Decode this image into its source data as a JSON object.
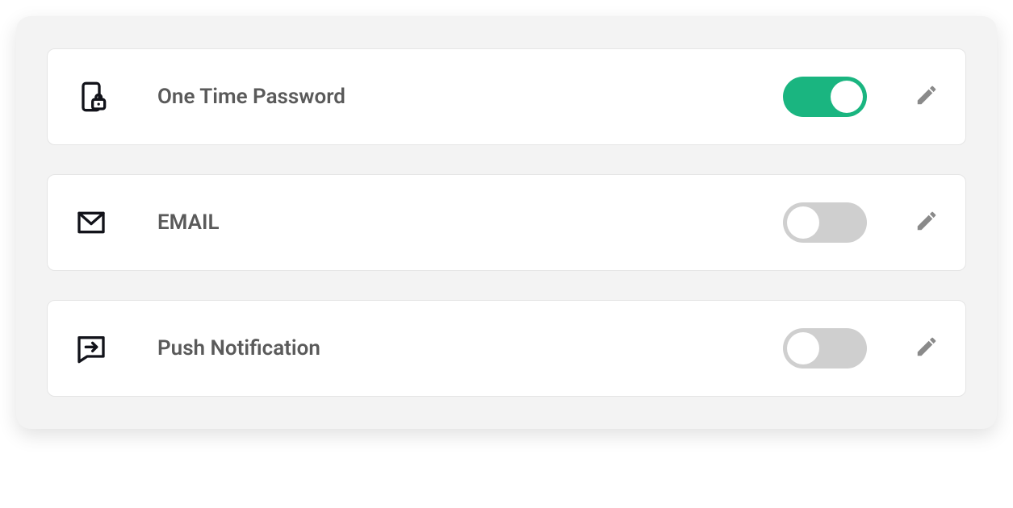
{
  "settings": [
    {
      "label": "One Time Password",
      "icon": "device-lock-icon",
      "enabled": true
    },
    {
      "label": "EMAIL",
      "icon": "email-icon",
      "enabled": false
    },
    {
      "label": "Push Notification",
      "icon": "chat-arrow-icon",
      "enabled": false
    }
  ],
  "colors": {
    "toggle_on": "#1ab580",
    "toggle_off": "#cfcfcf",
    "icon_stroke": "#12131a",
    "edit_icon": "#8a8a8a",
    "label": "#5a5a5a"
  }
}
